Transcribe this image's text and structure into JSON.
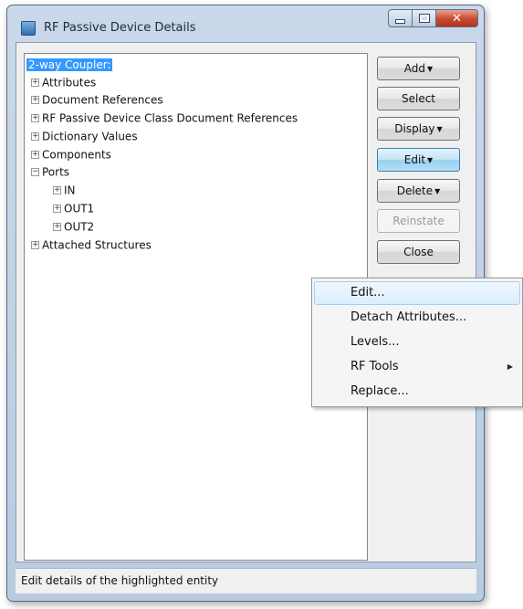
{
  "window": {
    "title": "RF Passive Device Details"
  },
  "tree": {
    "root": "2-way Coupler:",
    "items": [
      {
        "label": "Attributes",
        "expander": "+"
      },
      {
        "label": "Document References",
        "expander": "+"
      },
      {
        "label": "RF Passive Device Class Document References",
        "expander": "+"
      },
      {
        "label": "Dictionary Values",
        "expander": "+"
      },
      {
        "label": "Components",
        "expander": "+"
      },
      {
        "label": "Ports",
        "expander": "−"
      },
      {
        "label": "IN",
        "expander": "+"
      },
      {
        "label": "OUT1",
        "expander": "+"
      },
      {
        "label": "OUT2",
        "expander": "+"
      },
      {
        "label": "Attached Structures",
        "expander": "+"
      }
    ]
  },
  "buttons": {
    "add": "Add",
    "select": "Select",
    "display": "Display",
    "edit": "Edit",
    "delete": "Delete",
    "reinstate": "Reinstate",
    "close": "Close"
  },
  "context_menu": {
    "items": [
      {
        "label": "Edit..."
      },
      {
        "label": "Detach Attributes..."
      },
      {
        "label": "Levels..."
      },
      {
        "label": "RF Tools"
      },
      {
        "label": "Replace..."
      }
    ]
  },
  "status": "Edit details of the highlighted entity"
}
